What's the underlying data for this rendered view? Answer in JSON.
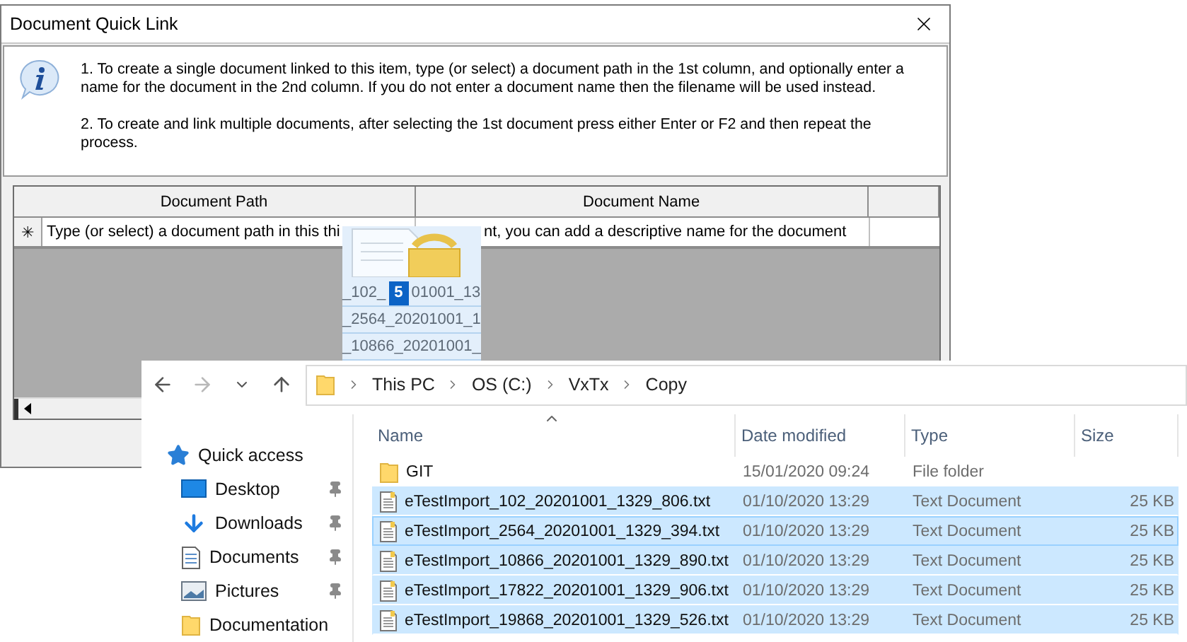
{
  "dialog": {
    "title": "Document Quick Link",
    "instructions": [
      "1. To create a single document linked to this item, type (or select) a document path in the 1st column, and optionally enter a name for the document in the 2nd column. If you do not enter a document name then the filename will be used instead.",
      "2. To create and link multiple documents, after selecting the 1st document press either Enter or F2  and then repeat the process."
    ],
    "grid": {
      "columns": [
        "Document Path",
        "Document Name"
      ],
      "new_row": {
        "marker": "✳",
        "cells": [
          "Type (or select) a document path in this thi",
          "nt, you can add a descriptive name for the document"
        ]
      }
    }
  },
  "drag_preview": {
    "count": "5",
    "rows": [
      "_102_",
      "_2564_20201001_1",
      "_10866_20201001_"
    ],
    "row_tail": "01001_13"
  },
  "explorer": {
    "breadcrumbs": [
      "This PC",
      "OS (C:)",
      "VxTx",
      "Copy"
    ],
    "nav_items": [
      {
        "label": "Quick access",
        "kind": "quick",
        "pinned": false
      },
      {
        "label": "Desktop",
        "kind": "desktop",
        "pinned": true
      },
      {
        "label": "Downloads",
        "kind": "downloads",
        "pinned": true
      },
      {
        "label": "Documents",
        "kind": "documents",
        "pinned": true
      },
      {
        "label": "Pictures",
        "kind": "pictures",
        "pinned": true
      },
      {
        "label": "Documentation",
        "kind": "folder",
        "pinned": false
      }
    ],
    "columns": [
      "Name",
      "Date modified",
      "Type",
      "Size"
    ],
    "files": [
      {
        "kind": "folder",
        "name": "GIT",
        "date": "15/01/2020 09:24",
        "type": "File folder",
        "selected": false,
        "focused": false
      },
      {
        "kind": "text",
        "name": "eTestImport_102_20201001_1329_806.txt",
        "date": "01/10/2020 13:29",
        "type": "Text Document",
        "size": "25 KB",
        "selected": true,
        "focused": false
      },
      {
        "kind": "text",
        "name": "eTestImport_2564_20201001_1329_394.txt",
        "date": "01/10/2020 13:29",
        "type": "Text Document",
        "size": "25 KB",
        "selected": true,
        "focused": true
      },
      {
        "kind": "text",
        "name": "eTestImport_10866_20201001_1329_890.txt",
        "date": "01/10/2020 13:29",
        "type": "Text Document",
        "size": "25 KB",
        "selected": true,
        "focused": false
      },
      {
        "kind": "text",
        "name": "eTestImport_17822_20201001_1329_906.txt",
        "date": "01/10/2020 13:29",
        "type": "Text Document",
        "size": "25 KB",
        "selected": true,
        "focused": false
      },
      {
        "kind": "text",
        "name": "eTestImport_19868_20201001_1329_526.txt",
        "date": "01/10/2020 13:29",
        "type": "Text Document",
        "size": "25 KB",
        "selected": true,
        "focused": false
      }
    ]
  }
}
